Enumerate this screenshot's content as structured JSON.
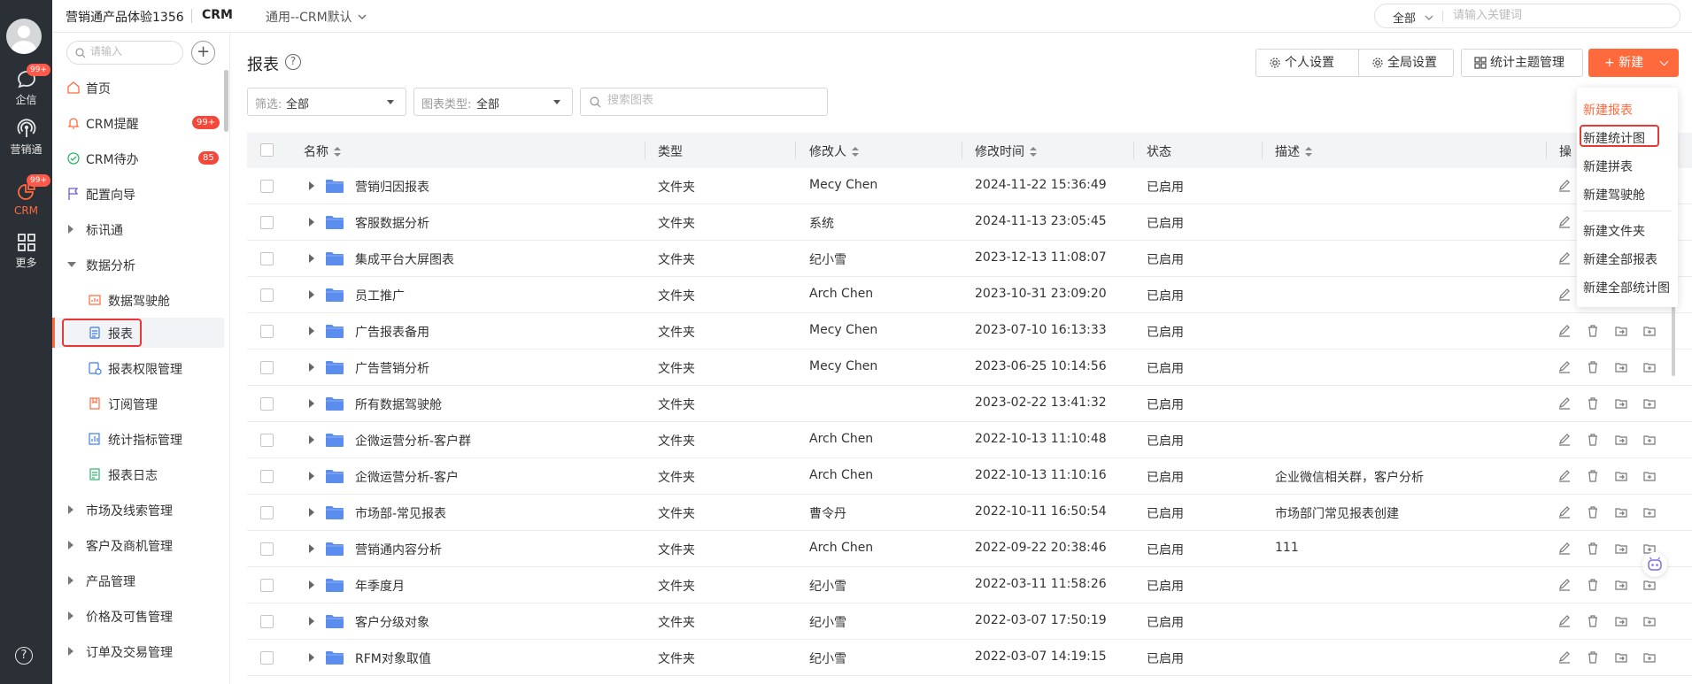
{
  "rail": {
    "items": [
      {
        "label": "企信",
        "badge": "99+",
        "icon": "chat-icon"
      },
      {
        "label": "营销通",
        "badge": "",
        "icon": "broadcast-icon"
      },
      {
        "label": "CRM",
        "badge": "99+",
        "icon": "pie-chart-icon",
        "active": true
      },
      {
        "label": "更多",
        "badge": "",
        "icon": "apps-grid-icon"
      }
    ],
    "help": "?"
  },
  "topbar": {
    "org": "营销通产品体验1356",
    "app": "CRM",
    "scheme": "通用--CRM默认",
    "search_scope": "全部",
    "search_placeholder": "请输入关键词"
  },
  "sidebar": {
    "search_placeholder": "请输入",
    "add": "+",
    "items": [
      {
        "label": "首页",
        "icon": "home-icon",
        "badge": ""
      },
      {
        "label": "CRM提醒",
        "icon": "bell-icon",
        "badge": "99+"
      },
      {
        "label": "CRM待办",
        "icon": "check-circle-icon",
        "badge": "85"
      },
      {
        "label": "配置向导",
        "icon": "flag-icon",
        "badge": ""
      },
      {
        "label": "标讯通",
        "expand": "collapsed"
      },
      {
        "label": "数据分析",
        "expand": "expanded"
      },
      {
        "label": "数据驾驶舱",
        "icon": "dashboard-icon",
        "sub": true
      },
      {
        "label": "报表",
        "icon": "report-icon",
        "sub": true,
        "selected": true
      },
      {
        "label": "报表权限管理",
        "icon": "report-permission-icon",
        "sub": true
      },
      {
        "label": "订阅管理",
        "icon": "subscribe-icon",
        "sub": true
      },
      {
        "label": "统计指标管理",
        "icon": "metric-icon",
        "sub": true
      },
      {
        "label": "报表日志",
        "icon": "log-icon",
        "sub": true
      },
      {
        "label": "市场及线索管理",
        "expand": "collapsed"
      },
      {
        "label": "客户及商机管理",
        "expand": "collapsed"
      },
      {
        "label": "产品管理",
        "expand": "collapsed"
      },
      {
        "label": "价格及可售管理",
        "expand": "collapsed"
      },
      {
        "label": "订单及交易管理",
        "expand": "collapsed"
      }
    ]
  },
  "main": {
    "title": "报表",
    "buttons": {
      "personal": "个人设置",
      "global": "全局设置",
      "theme": "统计主题管理",
      "new": "+ 新建"
    },
    "filters": {
      "filter_label": "筛选:",
      "filter_value": "全部",
      "type_label": "图表类型:",
      "type_value": "全部",
      "search_placeholder": "搜索图表"
    },
    "columns": {
      "name": "名称",
      "type": "类型",
      "modifier": "修改人",
      "modified": "修改时间",
      "status": "状态",
      "desc": "描述",
      "ops": "操"
    },
    "rows": [
      {
        "name": "营销归因报表",
        "type": "文件夹",
        "modifier": "Mecy Chen",
        "modified": "2024-11-22 15:36:49",
        "status": "已启用",
        "desc": ""
      },
      {
        "name": "客服数据分析",
        "type": "文件夹",
        "modifier": "系统",
        "modified": "2024-11-13 23:05:45",
        "status": "已启用",
        "desc": ""
      },
      {
        "name": "集成平台大屏图表",
        "type": "文件夹",
        "modifier": "纪小雪",
        "modified": "2023-12-13 11:08:07",
        "status": "已启用",
        "desc": ""
      },
      {
        "name": "员工推广",
        "type": "文件夹",
        "modifier": "Arch Chen",
        "modified": "2023-10-31 23:09:20",
        "status": "已启用",
        "desc": ""
      },
      {
        "name": "广告报表备用",
        "type": "文件夹",
        "modifier": "Mecy Chen",
        "modified": "2023-07-10 16:13:33",
        "status": "已启用",
        "desc": ""
      },
      {
        "name": "广告营销分析",
        "type": "文件夹",
        "modifier": "Mecy Chen",
        "modified": "2023-06-25 10:14:56",
        "status": "已启用",
        "desc": ""
      },
      {
        "name": "所有数据驾驶舱",
        "type": "文件夹",
        "modifier": "",
        "modified": "2023-02-22 13:41:32",
        "status": "已启用",
        "desc": ""
      },
      {
        "name": "企微运营分析-客户群",
        "type": "文件夹",
        "modifier": "Arch Chen",
        "modified": "2022-10-13 11:10:48",
        "status": "已启用",
        "desc": ""
      },
      {
        "name": "企微运营分析-客户",
        "type": "文件夹",
        "modifier": "Arch Chen",
        "modified": "2022-10-13 11:10:16",
        "status": "已启用",
        "desc": "企业微信相关群，客户分析"
      },
      {
        "name": "市场部-常见报表",
        "type": "文件夹",
        "modifier": "曹令丹",
        "modified": "2022-10-11 16:50:54",
        "status": "已启用",
        "desc": "市场部门常见报表创建"
      },
      {
        "name": "营销通内容分析",
        "type": "文件夹",
        "modifier": "Arch Chen",
        "modified": "2022-09-22 20:38:46",
        "status": "已启用",
        "desc": "111"
      },
      {
        "name": "年季度月",
        "type": "文件夹",
        "modifier": "纪小雪",
        "modified": "2022-03-11 11:58:26",
        "status": "已启用",
        "desc": ""
      },
      {
        "name": "客户分级对象",
        "type": "文件夹",
        "modifier": "纪小雪",
        "modified": "2022-03-07 17:50:19",
        "status": "已启用",
        "desc": ""
      },
      {
        "name": "RFM对象取值",
        "type": "文件夹",
        "modifier": "纪小雪",
        "modified": "2022-03-07 14:19:15",
        "status": "已启用",
        "desc": ""
      }
    ]
  },
  "new_menu": {
    "items": [
      "新建报表",
      "新建统计图",
      "新建拼表",
      "新建驾驶舱",
      "新建文件夹",
      "新建全部报表",
      "新建全部统计图"
    ]
  },
  "colors": {
    "accent": "#ff6a3d",
    "rail_bg": "#2b2f36",
    "badge_red": "#f5483b",
    "highlight_box": "#e53935",
    "folder_blue": "#5b8def"
  }
}
